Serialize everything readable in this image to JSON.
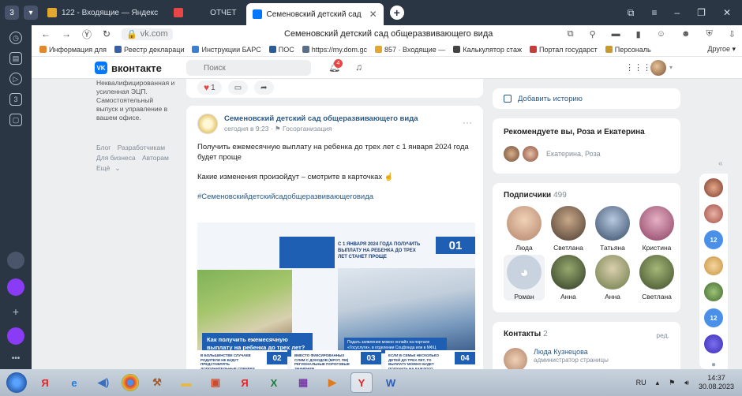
{
  "tabs": [
    {
      "label": "122 - Входящие — Яндекс",
      "color": "#e3a62f"
    },
    {
      "label": "ОТЧЕТ",
      "color": "#e64646"
    },
    {
      "label": "Семеновский детский сад",
      "color": "#0077ff",
      "active": true
    }
  ],
  "tab_counter": "3",
  "address": {
    "url": "vk.com",
    "page_title": "Семеновский детский сад общеразвивающего вида"
  },
  "bookmarks": [
    {
      "label": "Информация для",
      "color": "#e28a2b"
    },
    {
      "label": "Реестр деклараци",
      "color": "#3a5fa8"
    },
    {
      "label": "Инструкции БАРС",
      "color": "#3a7fd1"
    },
    {
      "label": "ПОС",
      "color": "#2a5c9a"
    },
    {
      "label": "https://my.dom.gc",
      "color": "#5b6f8a"
    },
    {
      "label": "857 · Входящие —",
      "color": "#e3a62f"
    },
    {
      "label": "Калькулятор стаж",
      "color": "#444"
    },
    {
      "label": "Портал государст",
      "color": "#c83b3b"
    },
    {
      "label": "Персональ",
      "color": "#c79a2e"
    }
  ],
  "bookmarks_other": "Другое",
  "vk": {
    "logo": "вконтакте",
    "search_placeholder": "Поиск",
    "notif_count": "4"
  },
  "leftnav": {
    "promo": "Неквалифицированная и усиленная ЭЦП. Самостоятельный выпуск и управление в вашем офисе.",
    "links": [
      "Блог",
      "Разработчикам",
      "Для бизнеса",
      "Авторам",
      "Ещё"
    ]
  },
  "post_actions": {
    "likes": "1"
  },
  "post": {
    "author": "Семеновский детский сад общеразвивающего вида",
    "meta_time": "сегодня в 9:23",
    "meta_type": "Госорганизация",
    "text1": "Получить ежемесячную выплату на ребенка до трех лет с 1 января 2024 года будет проще",
    "text2": "Какие изменения произойдут – смотрите в карточках",
    "hashtag": "#Семеновскийдетскийсадобщеразвивающеговида",
    "infographic": {
      "num1": "01",
      "headline": "С 1 января 2024 года получить выплату на ребенка до трех лет станет проще",
      "question": "Как получить ежемесячную выплату на ребенка до трех лет?",
      "note": "Подать заявление можно онлайн на портале «Госуслуги», в отделении Соцфонда или в МФЦ",
      "cells": [
        {
          "num": "02",
          "text": "В большинстве случаев родители не будут представлять дополнительные справки"
        },
        {
          "num": "03",
          "text": "Вместо фиксированных сумм с доходов (МРОТ, ПМ) региональные пороговые значения"
        },
        {
          "num": "04",
          "text": "Если в семье несколько детей до трех лет, то выплату можно будет получать на каждого"
        }
      ]
    }
  },
  "right": {
    "story": "Добавить историю",
    "recommend_title": "Рекомендуете вы, Роза и Екатерина",
    "recommend_names": "Екатерина, Роза",
    "subs_title": "Подписчики",
    "subs_count": "499",
    "subscribers": [
      "Люда",
      "Светлана",
      "Татьяна",
      "Кристина",
      "Роман",
      "Анна",
      "Анна",
      "Светлана"
    ],
    "contacts_title": "Контакты",
    "contacts_count": "2",
    "contacts_edit": "ред.",
    "contact_name": "Люда Кузнецова",
    "contact_role": "администратор страницы"
  },
  "strip_badges": [
    "12",
    "12"
  ],
  "taskbar": {
    "lang": "RU",
    "time": "14:37",
    "date": "30.08.2023"
  }
}
